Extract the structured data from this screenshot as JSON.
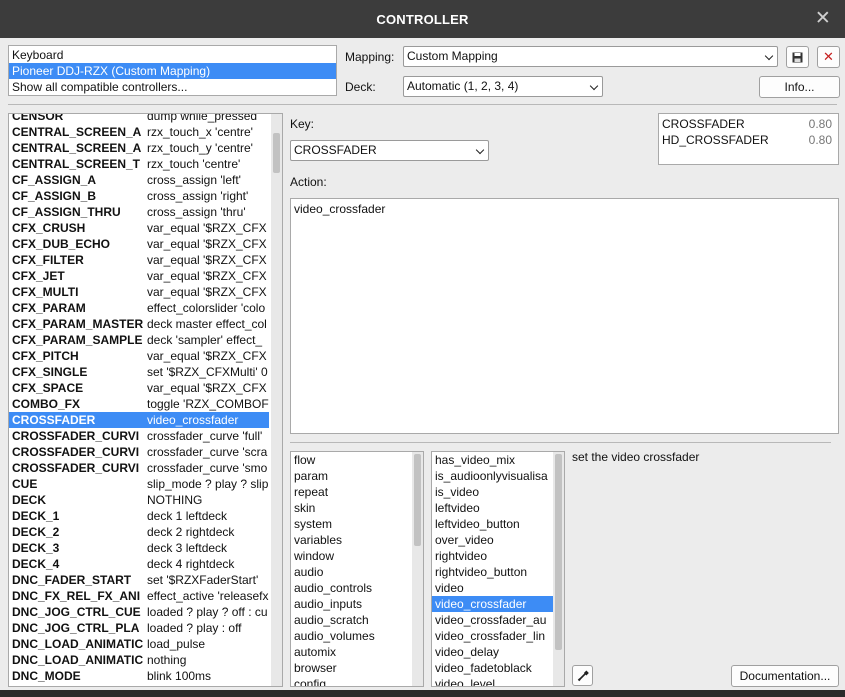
{
  "window": {
    "title": "CONTROLLER"
  },
  "controllers": [
    "Keyboard",
    "Pioneer DDJ-RZX (Custom Mapping)",
    "Show all compatible controllers..."
  ],
  "controllers_selected": 1,
  "mapping": {
    "label": "Mapping:",
    "value": "Custom Mapping"
  },
  "deck": {
    "label": "Deck:",
    "value": "Automatic (1, 2, 3, 4)"
  },
  "info_label": "Info...",
  "key": {
    "label": "Key:",
    "value": "CROSSFADER"
  },
  "action": {
    "label": "Action:",
    "value": "video_crossfader"
  },
  "key_values": [
    {
      "name": "CROSSFADER",
      "value": "0.80"
    },
    {
      "name": "HD_CROSSFADER",
      "value": "0.80"
    }
  ],
  "mappings_selected": 19,
  "mappings": [
    [
      "CENSOR",
      "dump while_pressed"
    ],
    [
      "CENTRAL_SCREEN_A",
      "rzx_touch_x 'centre'"
    ],
    [
      "CENTRAL_SCREEN_A",
      "rzx_touch_y 'centre'"
    ],
    [
      "CENTRAL_SCREEN_T",
      "rzx_touch 'centre'"
    ],
    [
      "CF_ASSIGN_A",
      "cross_assign 'left'"
    ],
    [
      "CF_ASSIGN_B",
      "cross_assign 'right'"
    ],
    [
      "CF_ASSIGN_THRU",
      "cross_assign 'thru'"
    ],
    [
      "CFX_CRUSH",
      "var_equal '$RZX_CFX"
    ],
    [
      "CFX_DUB_ECHO",
      "var_equal '$RZX_CFX"
    ],
    [
      "CFX_FILTER",
      "var_equal '$RZX_CFX"
    ],
    [
      "CFX_JET",
      "var_equal '$RZX_CFX"
    ],
    [
      "CFX_MULTI",
      "var_equal '$RZX_CFX"
    ],
    [
      "CFX_PARAM",
      "effect_colorslider 'colo"
    ],
    [
      "CFX_PARAM_MASTER",
      "deck master effect_col"
    ],
    [
      "CFX_PARAM_SAMPLE",
      "deck 'sampler' effect_"
    ],
    [
      "CFX_PITCH",
      "var_equal '$RZX_CFX"
    ],
    [
      "CFX_SINGLE",
      "set '$RZX_CFXMulti' 0"
    ],
    [
      "CFX_SPACE",
      "var_equal '$RZX_CFX"
    ],
    [
      "COMBO_FX",
      "toggle 'RZX_COMBOF"
    ],
    [
      "CROSSFADER",
      "video_crossfader"
    ],
    [
      "CROSSFADER_CURVI",
      "crossfader_curve 'full'"
    ],
    [
      "CROSSFADER_CURVI",
      "crossfader_curve 'scra"
    ],
    [
      "CROSSFADER_CURVI",
      "crossfader_curve 'smo"
    ],
    [
      "CUE",
      "slip_mode ? play ? slip"
    ],
    [
      "DECK",
      "NOTHING"
    ],
    [
      "DECK_1",
      "deck 1 leftdeck"
    ],
    [
      "DECK_2",
      "deck 2 rightdeck"
    ],
    [
      "DECK_3",
      "deck 3 leftdeck"
    ],
    [
      "DECK_4",
      "deck 4 rightdeck"
    ],
    [
      "DNC_FADER_START",
      "set '$RZXFaderStart'"
    ],
    [
      "DNC_FX_REL_FX_ANI",
      "effect_active 'releasefx"
    ],
    [
      "DNC_JOG_CTRL_CUE",
      "loaded ? play ? off : cu"
    ],
    [
      "DNC_JOG_CTRL_PLA",
      "loaded ? play : off"
    ],
    [
      "DNC_LOAD_ANIMATIC",
      "load_pulse"
    ],
    [
      "DNC_LOAD_ANIMATIC",
      "nothing"
    ],
    [
      "DNC_MODE",
      "blink 100ms"
    ]
  ],
  "categories": [
    "flow",
    "param",
    "repeat",
    "skin",
    "system",
    "variables",
    "window",
    "audio",
    "audio_controls",
    "audio_inputs",
    "audio_scratch",
    "audio_volumes",
    "automix",
    "browser",
    "config"
  ],
  "verbs_selected": 9,
  "verbs": [
    "has_video_mix",
    "is_audioonlyvisualisa",
    "is_video",
    "leftvideo",
    "leftvideo_button",
    "over_video",
    "rightvideo",
    "rightvideo_button",
    "video",
    "video_crossfader",
    "video_crossfader_au",
    "video_crossfader_lin",
    "video_delay",
    "video_fadetoblack",
    "video_level"
  ],
  "description": "set the video crossfader",
  "documentation_label": "Documentation..."
}
